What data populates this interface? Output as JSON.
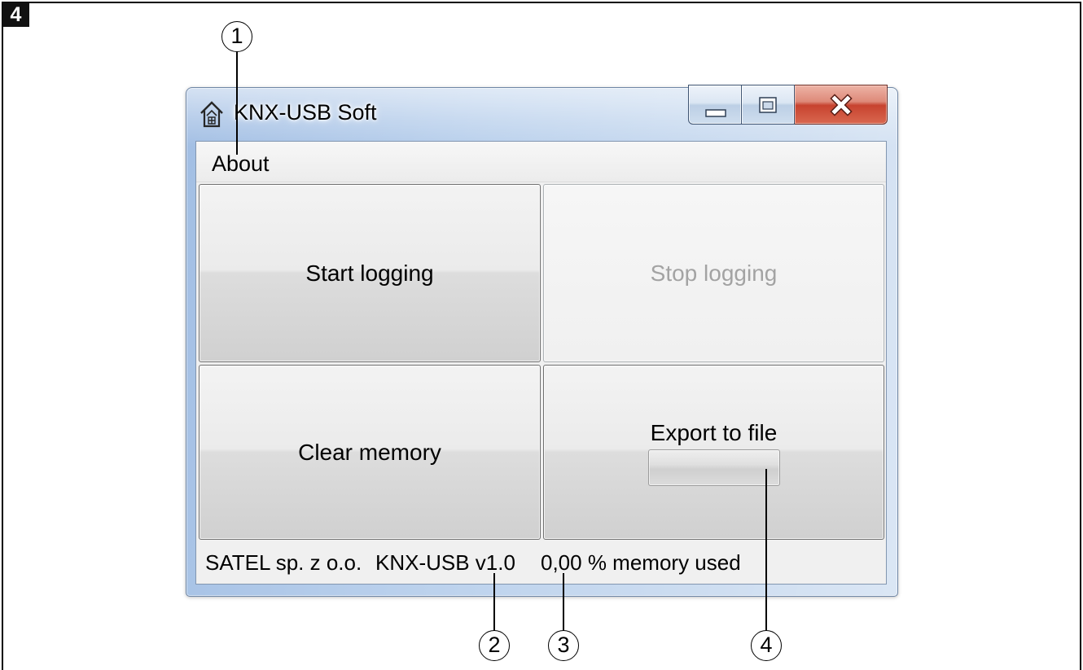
{
  "figure": {
    "badge": "4",
    "callouts": [
      {
        "number": "1"
      },
      {
        "number": "2"
      },
      {
        "number": "3"
      },
      {
        "number": "4"
      }
    ]
  },
  "window": {
    "title": "KNX-USB Soft",
    "icons": {
      "app": "house-icon",
      "minimize": "minimize-icon",
      "maximize": "maximize-icon",
      "close": "close-icon"
    },
    "menu": [
      {
        "label": "About"
      }
    ],
    "buttons": {
      "start_logging": {
        "label": "Start logging",
        "enabled": true
      },
      "stop_logging": {
        "label": "Stop logging",
        "enabled": false
      },
      "clear_memory": {
        "label": "Clear memory",
        "enabled": true
      },
      "export_to_file": {
        "label": "Export to file",
        "enabled": true,
        "progress_percent": 0
      }
    },
    "status_bar": {
      "company": "SATEL sp. z o.o.",
      "version": "KNX-USB v1.0",
      "memory_used": "0,00 % memory used"
    }
  },
  "colors": {
    "frame_blue": "#c4d7ee",
    "close_red": "#c7432f",
    "disabled_text": "#a3a3a3",
    "button_border": "#707070",
    "client_bg": "#f0f0f0"
  }
}
